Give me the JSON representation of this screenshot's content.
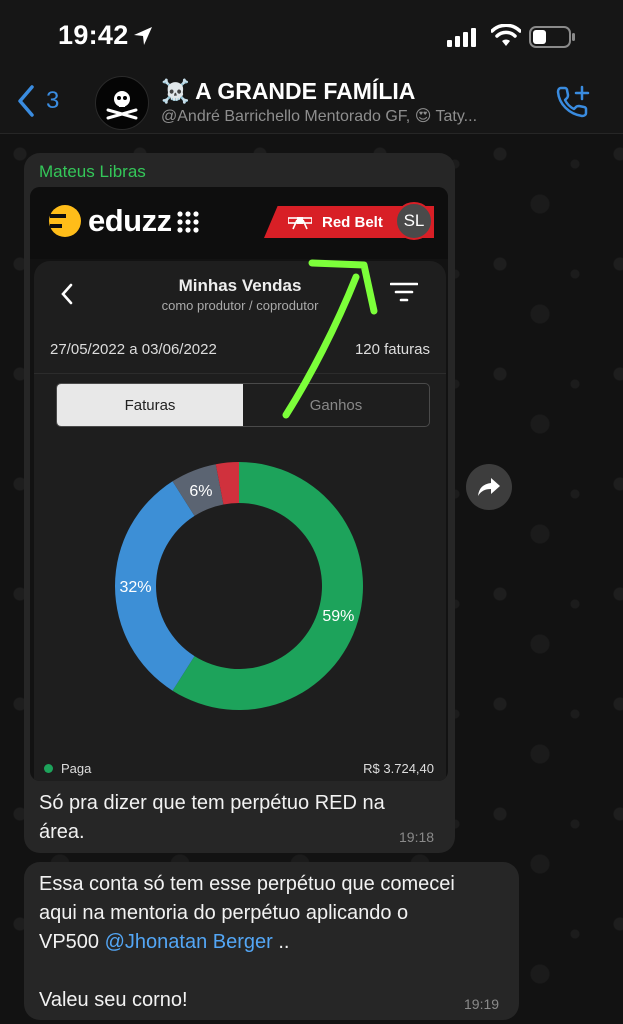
{
  "status_bar": {
    "time": "19:42"
  },
  "header": {
    "back_count": "3",
    "title": "☠️ A GRANDE FAMÍLIA",
    "subtitle": "@André Barrichello Mentorado GF, 😍 Taty..."
  },
  "message1": {
    "sender": "Mateus Libras",
    "image": {
      "brand": "eduzz",
      "badge": "Red Belt",
      "avatar_initials": "SL",
      "screen_title": "Minhas Vendas",
      "screen_subtitle": "como produtor / coprodutor",
      "date_range": "27/05/2022 a 03/06/2022",
      "invoice_count": "120 faturas",
      "tabs": [
        "Faturas",
        "Ganhos"
      ],
      "active_tab": "Faturas",
      "legend_label": "Paga",
      "amount": "R$  3.724,40"
    },
    "text": "Só pra dizer que tem perpétuo RED na área.",
    "text_line1": "Só pra dizer que tem perpétuo RED na",
    "text_line2": "área.",
    "time": "19:18"
  },
  "message2": {
    "line1": "Essa conta só tem esse perpétuo que comecei",
    "line2": "aqui na mentoria do perpétuo aplicando o",
    "line3_prefix": "VP500 ",
    "mention": "@Jhonatan Berger",
    "line3_suffix": " ..",
    "line5": "Valeu seu corno!",
    "time": "19:19"
  },
  "chart_data": {
    "type": "pie",
    "style": "donut",
    "categories": [
      "Green",
      "Blue",
      "Gray",
      "Red"
    ],
    "values": [
      59,
      32,
      6,
      3
    ],
    "labels": [
      "59%",
      "32%",
      "6%",
      ""
    ],
    "colors": [
      "#1da35b",
      "#3d8fd6",
      "#5b6472",
      "#d0313d"
    ]
  }
}
